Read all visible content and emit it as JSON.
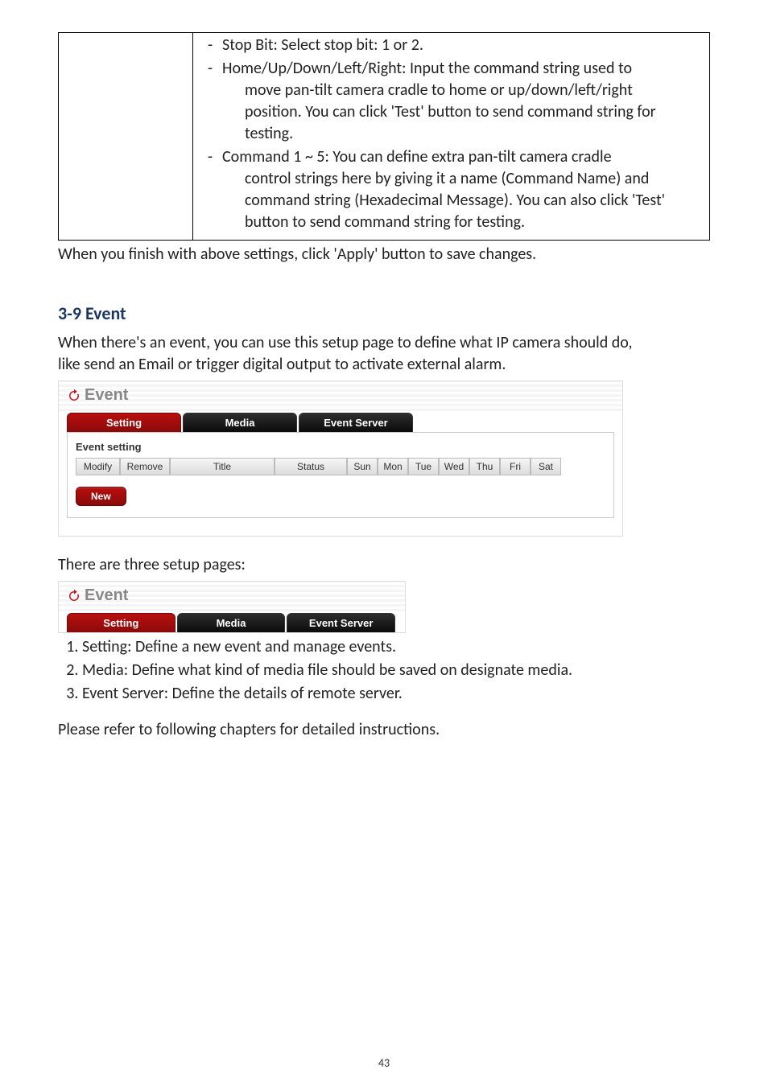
{
  "table": {
    "item1": "Stop Bit: Select stop bit: 1 or 2.",
    "item2_l1": "Home/Up/Down/Left/Right: Input the command string used to",
    "item2_l2": "move pan-tilt camera cradle to home or up/down/left/right",
    "item2_l3": "position. You can click 'Test' button to send command string for",
    "item2_l4": "testing.",
    "item3_l1": "Command 1 ~ 5: You can define extra pan-tilt camera cradle",
    "item3_l2": "control strings here by giving it a name (Command Name) and",
    "item3_l3": "command string (Hexadecimal Message). You can also click 'Test'",
    "item3_l4": "button to send command string for testing."
  },
  "after_table": "When you finish with above settings, click 'Apply' button to save changes.",
  "section_heading": "3-9 Event",
  "section_intro_l1": "When there's an event, you can use this setup page to define what IP camera should do,",
  "section_intro_l2": "like send an Email or trigger digital output to activate external alarm.",
  "ui": {
    "title": "Event",
    "tabs": {
      "setting": "Setting",
      "media": "Media",
      "server": "Event Server"
    },
    "panel_title": "Event setting",
    "cols": {
      "modify": "Modify",
      "remove": "Remove",
      "title": "Title",
      "status": "Status",
      "sun": "Sun",
      "mon": "Mon",
      "tue": "Tue",
      "wed": "Wed",
      "thu": "Thu",
      "fri": "Fri",
      "sat": "Sat"
    },
    "new_label": "New"
  },
  "pages_header": "There are three setup pages:",
  "list": {
    "i1": "Setting: Define a new event and manage events.",
    "i2": "Media: Define what kind of media file should be saved on designate media.",
    "i3": "Event Server: Define the details of remote server."
  },
  "outro": "Please refer to following chapters for detailed instructions.",
  "page_number": "43"
}
